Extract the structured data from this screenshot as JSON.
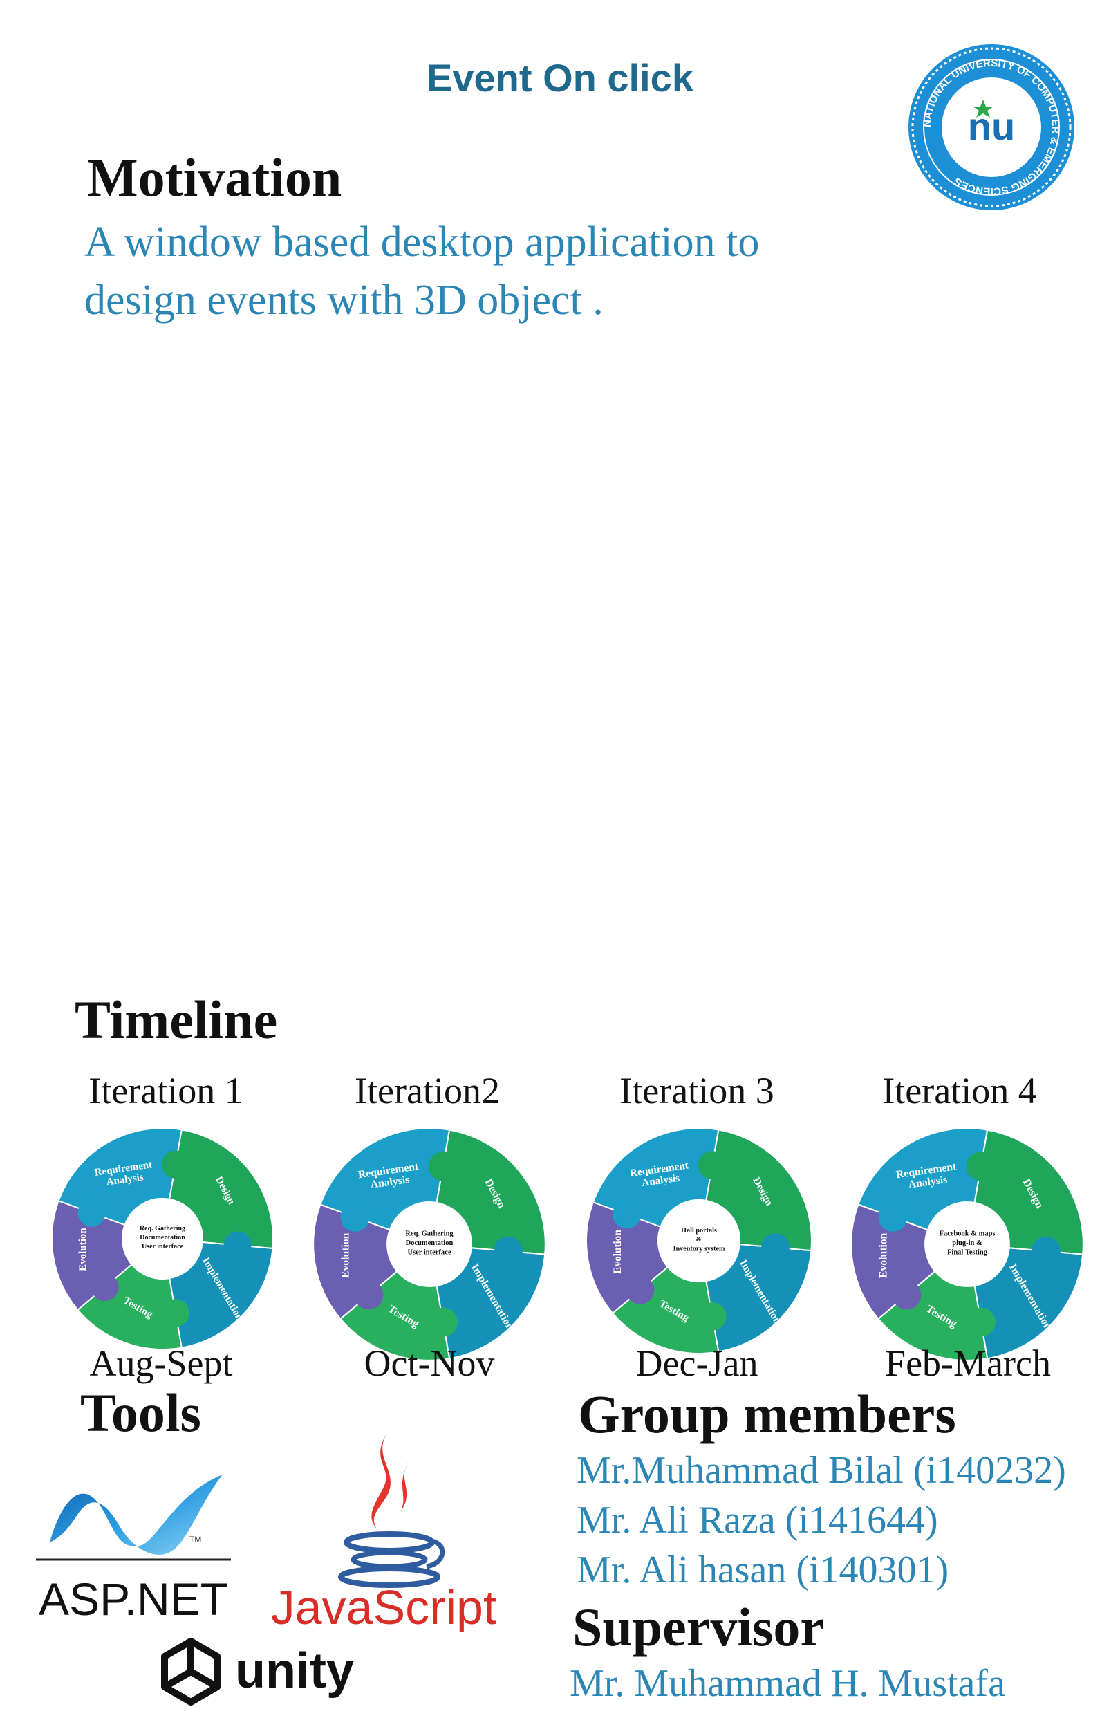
{
  "header": {
    "title": "Event On click"
  },
  "motivation": {
    "heading": "Motivation",
    "line1": "A window based desktop application to",
    "line2": "design events with 3D object ."
  },
  "timeline": {
    "heading": "Timeline",
    "wheel_labels": {
      "requirement": [
        "Requirement",
        "Analysis"
      ],
      "design": "Design",
      "implementation": "Implementation",
      "testing": "Testing",
      "evolution": "Evolution"
    },
    "iterations": [
      {
        "label": "Iteration 1",
        "period": "Aug-Sept",
        "center": [
          "Req. Gathering",
          "Documentation",
          "User interface"
        ]
      },
      {
        "label": "Iteration2",
        "period": "Oct-Nov",
        "center": [
          "Req. Gathering",
          "Documentation",
          "User interface"
        ]
      },
      {
        "label": "Iteration 3",
        "period": "Dec-Jan",
        "center": [
          "Hall portals",
          "&",
          "Inventory system"
        ]
      },
      {
        "label": "Iteration 4",
        "period": "Feb-March",
        "center": [
          "Facebook & maps",
          "plug-in &",
          "Final Testing"
        ]
      }
    ]
  },
  "tools": {
    "heading": "Tools",
    "items": [
      {
        "name": "ASP.NET",
        "icon": "aspnet-logo"
      },
      {
        "name": "JavaScript",
        "icon": "java-cup-logo"
      },
      {
        "name": "unity",
        "icon": "unity-logo"
      }
    ]
  },
  "group": {
    "heading": "Group members",
    "members": [
      "Mr.Muhammad Bilal (i140232)",
      "Mr. Ali Raza (i141644)",
      "Mr. Ali hasan (i140301)"
    ]
  },
  "supervisor": {
    "heading": "Supervisor",
    "name": "Mr. Muhammad H. Mustafa"
  },
  "logo": {
    "seal_text": "NATIONAL UNIVERSITY OF COMPUTER & EMERGING SCIENCES",
    "mark": "nu"
  },
  "colors": {
    "title": "#1f6a8c",
    "body_blue": "#2b86b5",
    "req": "#1b9fc9",
    "design": "#1fa65a",
    "impl": "#1591b8",
    "testing": "#29b05f",
    "evolution": "#6a5fb1"
  }
}
